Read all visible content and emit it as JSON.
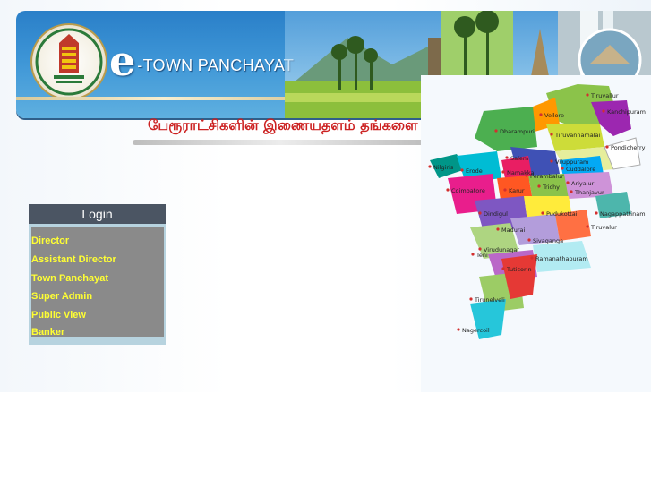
{
  "banner": {
    "logo_letter": "e",
    "logo_text": "-TOWN PANCHAYAT"
  },
  "tagline": "பேரூராட்சிகளின் இணையதளம் தங்களை",
  "login": {
    "title": "Login",
    "items": [
      {
        "label": "Director"
      },
      {
        "label": "Assistant Director"
      },
      {
        "label": "Town Panchayat"
      },
      {
        "label": "Super Admin"
      },
      {
        "label": "Public View"
      },
      {
        "label": "Banker"
      }
    ]
  },
  "map": {
    "districts": [
      "Tiruvallur",
      "Vellore",
      "Kanchipuram",
      "Dharampuri",
      "Tiruvannamalai",
      "Pondicherry",
      "Salem",
      "Viluppuram",
      "Nilgiris",
      "Erode",
      "Namakkal",
      "Cuddalore",
      "Perambalur",
      "Ariyalur",
      "Coimbatore",
      "Karur",
      "Trichy",
      "Thanjavur",
      "Nagappattinam",
      "Tiruvalur",
      "Dindigul",
      "Pudukottai",
      "Madurai",
      "Teni",
      "Sivaganga",
      "Virudunagar",
      "Ramanathapuram",
      "Tirunelveli",
      "Tuticorin",
      "Nagercoil"
    ]
  }
}
